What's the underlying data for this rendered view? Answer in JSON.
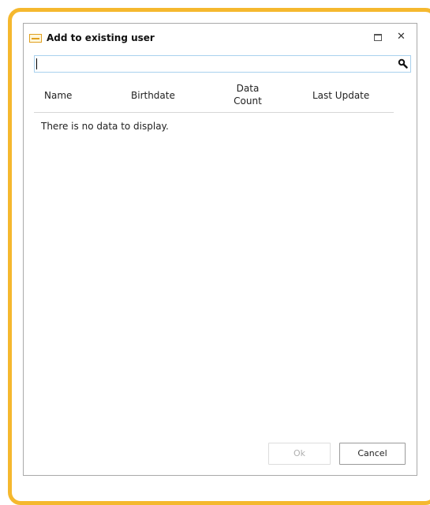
{
  "window": {
    "title": "Add to existing user",
    "icons": {
      "app": "app-logo-icon",
      "maximize": "maximize-icon",
      "close": "close-icon",
      "search": "search-icon"
    },
    "close_glyph": "✕"
  },
  "search": {
    "value": "",
    "placeholder": ""
  },
  "grid": {
    "columns": [
      "Name",
      "Birthdate",
      "Data\nCount",
      "Last Update"
    ],
    "empty_message": "There is no data to display."
  },
  "buttons": {
    "ok": "Ok",
    "cancel": "Cancel"
  },
  "colors": {
    "frame_accent": "#f5b82e",
    "search_border": "#a9d1ee"
  }
}
